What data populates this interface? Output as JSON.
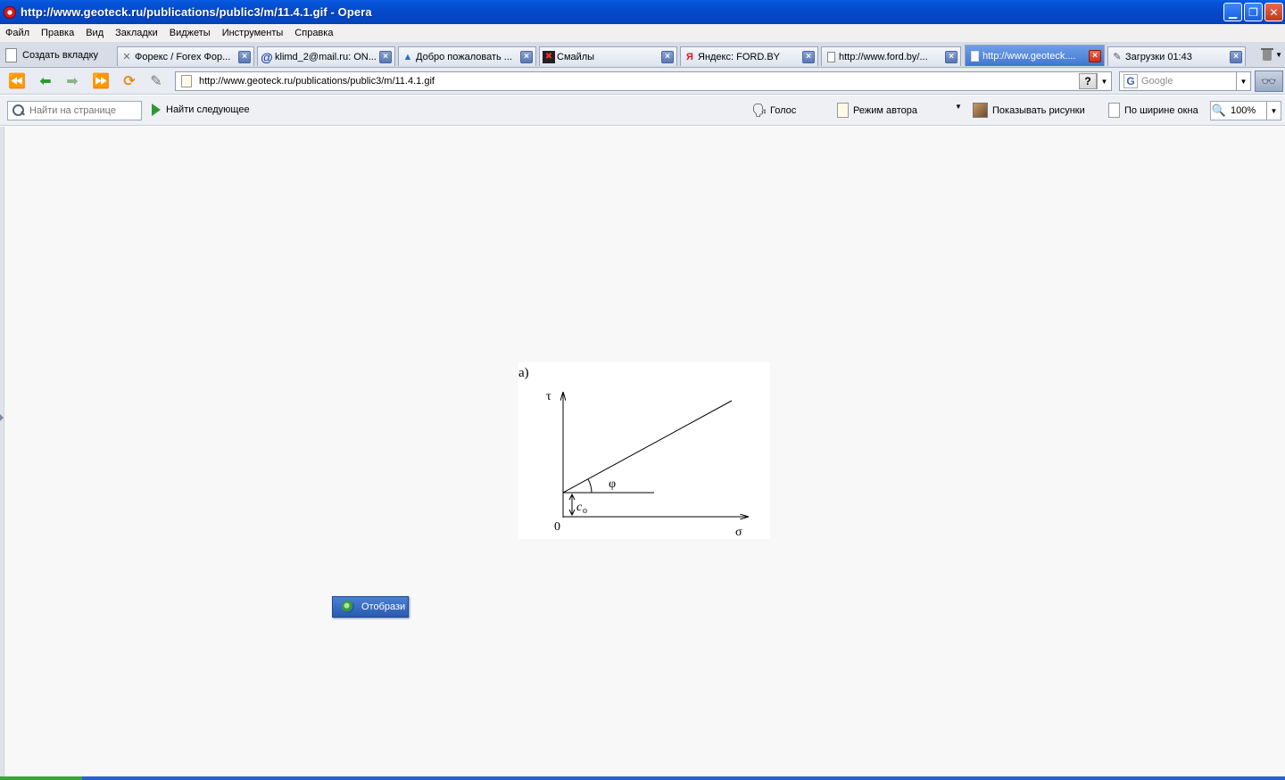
{
  "window": {
    "title": "http://www.geoteck.ru/publications/public3/m/11.4.1.gif - Opera",
    "minimize_icon": "minimize-icon",
    "maximize_icon": "restore-icon",
    "close_icon": "close-icon"
  },
  "menu": {
    "items": [
      "Файл",
      "Правка",
      "Вид",
      "Закладки",
      "Виджеты",
      "Инструменты",
      "Справка"
    ]
  },
  "tabs": {
    "new_tab_label": "Создать вкладку",
    "items": [
      {
        "label": "Форекс / Forex Фор...",
        "icon": "forex-icon",
        "active": false
      },
      {
        "label": "klimd_2@mail.ru: ON...",
        "icon": "mail-at-icon",
        "active": false
      },
      {
        "label": "Добро пожаловать ...",
        "icon": "triangle-icon",
        "active": false
      },
      {
        "label": "Смайлы",
        "icon": "smiley-site-icon",
        "active": false
      },
      {
        "label": "Яндекс: FORD.BY",
        "icon": "yandex-icon",
        "active": false
      },
      {
        "label": "http://www.ford.by/...",
        "icon": "page-icon",
        "active": false
      },
      {
        "label": "http://www.geoteck....",
        "icon": "page-icon",
        "active": true
      },
      {
        "label": "Загрузки 01:43",
        "icon": "download-icon",
        "active": false
      }
    ]
  },
  "nav": {
    "address": "http://www.geoteck.ru/publications/public3/m/11.4.1.gif",
    "help_label": "?",
    "search_placeholder": "Google",
    "search_engine_letter": "G"
  },
  "findbar": {
    "placeholder": "Найти на странице",
    "find_next": "Найти следующее",
    "voice": "Голос",
    "author_mode": "Режим автора",
    "show_images": "Показывать рисунки",
    "fit_width": "По ширине окна",
    "zoom": "100%"
  },
  "figure": {
    "label": "a)",
    "y_axis": "τ",
    "x_axis": "σ",
    "origin": "0",
    "angle": "φ",
    "intercept": "c",
    "intercept_sub": "o"
  },
  "page_button": {
    "label": "Отобрази"
  }
}
